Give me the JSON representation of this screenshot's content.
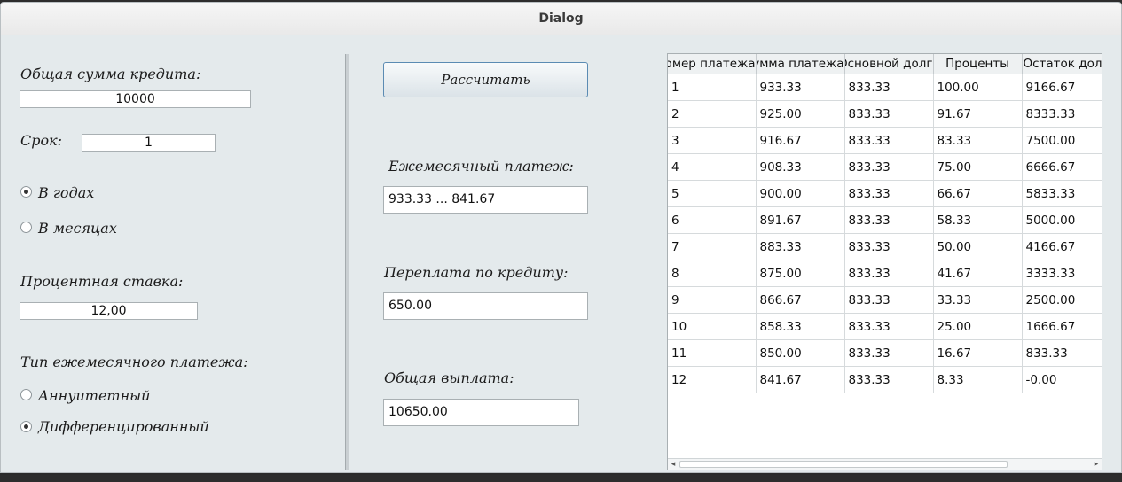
{
  "window": {
    "title": "Dialog"
  },
  "left": {
    "loan_amount_label": "Общая сумма кредита:",
    "loan_amount_value": "10000",
    "term_label": "Срок:",
    "term_value": "1",
    "term_unit_years": "В годах",
    "term_unit_months": "В месяцах",
    "term_unit_selected": "years",
    "rate_label": "Процентная ставка:",
    "rate_value": "12,00",
    "payment_type_label": "Тип ежемесячного платежа:",
    "payment_type_annuity": "Аннуитетный",
    "payment_type_diff": "Дифференцированный",
    "payment_type_selected": "differentiated"
  },
  "middle": {
    "calculate_button": "Рассчитать",
    "monthly_payment_label": "Ежемесячный платеж:",
    "monthly_payment_value": "933.33 ... 841.67",
    "overpayment_label": "Переплата по кредиту:",
    "overpayment_value": "650.00",
    "total_label": "Общая выплата:",
    "total_value": "10650.00"
  },
  "table": {
    "headers": [
      "Номер платежа",
      "Сумма платежа",
      "Основной долг",
      "Проценты",
      "Остаток долга"
    ],
    "rows": [
      [
        "1",
        "933.33",
        "833.33",
        "100.00",
        "9166.67"
      ],
      [
        "2",
        "925.00",
        "833.33",
        "91.67",
        "8333.33"
      ],
      [
        "3",
        "916.67",
        "833.33",
        "83.33",
        "7500.00"
      ],
      [
        "4",
        "908.33",
        "833.33",
        "75.00",
        "6666.67"
      ],
      [
        "5",
        "900.00",
        "833.33",
        "66.67",
        "5833.33"
      ],
      [
        "6",
        "891.67",
        "833.33",
        "58.33",
        "5000.00"
      ],
      [
        "7",
        "883.33",
        "833.33",
        "50.00",
        "4166.67"
      ],
      [
        "8",
        "875.00",
        "833.33",
        "41.67",
        "3333.33"
      ],
      [
        "9",
        "866.67",
        "833.33",
        "33.33",
        "2500.00"
      ],
      [
        "10",
        "858.33",
        "833.33",
        "25.00",
        "1666.67"
      ],
      [
        "11",
        "850.00",
        "833.33",
        "16.67",
        "833.33"
      ],
      [
        "12",
        "841.67",
        "833.33",
        "8.33",
        "-0.00"
      ]
    ],
    "scroll_left_glyph": "◂",
    "scroll_right_glyph": "▸"
  }
}
